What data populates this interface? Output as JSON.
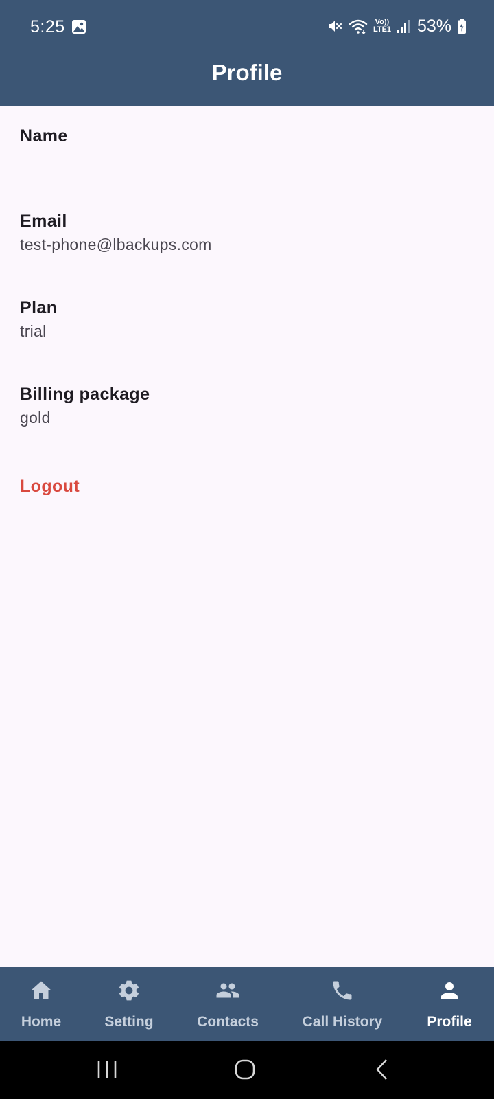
{
  "status_bar": {
    "time": "5:25",
    "volte_top": "Vo))",
    "volte_bottom": "LTE1",
    "battery": "53%",
    "icons": [
      "gallery-icon",
      "mute-icon",
      "wifi-icon",
      "volte-icon",
      "signal-icon",
      "battery-icon"
    ]
  },
  "app_bar": {
    "title": "Profile"
  },
  "profile": {
    "name_label": "Name",
    "name_value": "",
    "email_label": "Email",
    "email_value": "test-phone@lbackups.com",
    "plan_label": "Plan",
    "plan_value": "trial",
    "billing_label": "Billing package",
    "billing_value": "gold",
    "logout_label": "Logout"
  },
  "bottom_nav": {
    "items": [
      {
        "label": "Home",
        "icon": "home-icon",
        "active": false
      },
      {
        "label": "Setting",
        "icon": "gear-icon",
        "active": false
      },
      {
        "label": "Contacts",
        "icon": "people-icon",
        "active": false
      },
      {
        "label": "Call History",
        "icon": "phone-icon",
        "active": false
      },
      {
        "label": "Profile",
        "icon": "person-icon",
        "active": true
      }
    ]
  },
  "system_nav": {
    "buttons": [
      "recent-apps-icon",
      "home-circle-icon",
      "back-icon"
    ]
  },
  "colors": {
    "primary": "#3c5675",
    "background": "#fcf7fd",
    "logout": "#d9493f",
    "nav_inactive": "#c5cfdc",
    "nav_active": "#ffffff"
  }
}
